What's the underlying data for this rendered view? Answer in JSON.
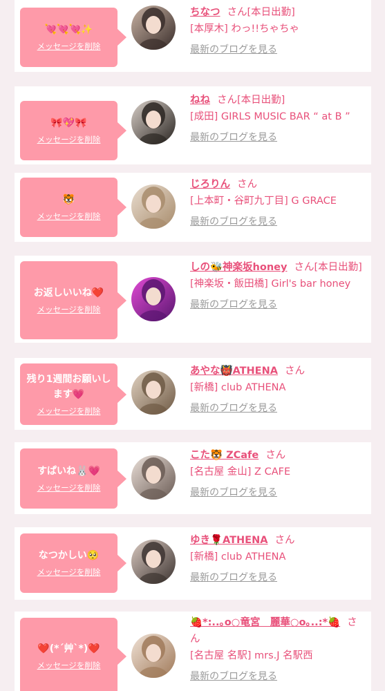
{
  "messages": [
    {
      "message": "💘💘💘✨",
      "delete_label": "メッセージを削除",
      "name": "ちなつ",
      "honorific": "さん",
      "status": "[本日出勤]",
      "shop": "[本厚木] わっ!!ちゃちゃ",
      "blog_label": "最新のブログを見る",
      "avatar_colors": [
        "#3a2e2b",
        "#c9b3a4"
      ]
    },
    {
      "message": "🎀💖🎀",
      "delete_label": "メッセージを削除",
      "name": "ねね",
      "honorific": "さん",
      "status": "[本日出勤]",
      "shop": "[成田] GIRLS MUSIC BAR “ at B ”",
      "blog_label": "最新のブログを見る",
      "avatar_colors": [
        "#2b2622",
        "#d8cfc8"
      ]
    },
    {
      "message": "🐯",
      "delete_label": "メッセージを削除",
      "name": "じろりん",
      "honorific": "さん",
      "status": "",
      "shop": "[上本町・谷町九丁目] G GRACE",
      "blog_label": "最新のブログを見る",
      "avatar_colors": [
        "#a88c6c",
        "#e9ddd0"
      ]
    },
    {
      "message": "お返しいいね❤️",
      "delete_label": "メッセージを削除",
      "name": "しの🐝神楽坂honey",
      "honorific": "さん",
      "status": "[本日出勤]",
      "shop": "[神楽坂・飯田橋] Girl's bar honey",
      "blog_label": "最新のブログを見る",
      "avatar_colors": [
        "#5a1670",
        "#e14bd4"
      ]
    },
    {
      "message": "残り1週間お願いします💗",
      "delete_label": "メッセージを削除",
      "name": "あやな👹ATHENA",
      "honorific": "さん",
      "status": "",
      "shop": "[新橋] club ATHENA",
      "blog_label": "最新のブログを見る",
      "avatar_colors": [
        "#6f5a45",
        "#e2d3c2"
      ]
    },
    {
      "message": "すぱいね🐰💗",
      "delete_label": "メッセージを削除",
      "name": "こた🐯 ZCafe",
      "honorific": "さん",
      "status": "",
      "shop": "[名古屋 金山] Z CAFE",
      "blog_label": "最新のブログを見る",
      "avatar_colors": [
        "#6b5c55",
        "#eadfd8"
      ]
    },
    {
      "message": "なつかしい🥺",
      "delete_label": "メッセージを削除",
      "name": "ゆき🌹ATHENA",
      "honorific": "さん",
      "status": "",
      "shop": "[新橋] club ATHENA",
      "blog_label": "最新のブログを見る",
      "avatar_colors": [
        "#3d3431",
        "#d9c9c0"
      ]
    },
    {
      "message": "❤️(*´艸`*)❤️",
      "delete_label": "メッセージを削除",
      "name": "🍓*:..｡o○竜宮　麗華○o｡..:*🍓",
      "honorific": "さん",
      "status": "",
      "shop": "[名古屋 名駅] mrs.J 名駅西",
      "blog_label": "最新のブログを見る",
      "avatar_colors": [
        "#a07a5a",
        "#f0e2d6"
      ]
    }
  ]
}
